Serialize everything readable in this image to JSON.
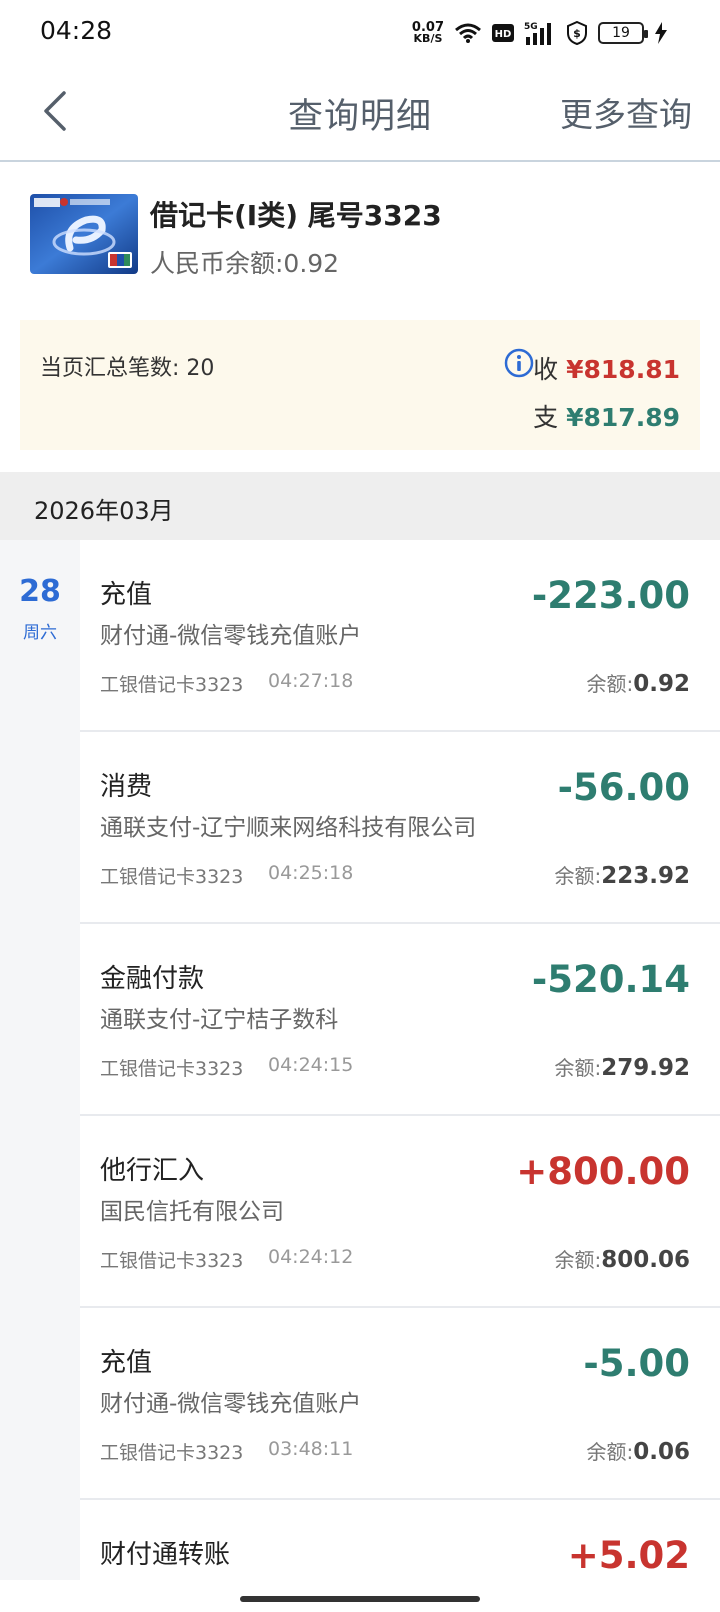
{
  "status": {
    "time": "04:28",
    "net_speed_value": "0.07",
    "net_speed_unit": "KB/S",
    "battery": "19",
    "icons": [
      "wifi-icon",
      "hd-icon",
      "5g-signal-icon",
      "shield-dollar-icon",
      "battery-icon",
      "charging-icon"
    ]
  },
  "nav": {
    "back_icon": "chevron-left-icon",
    "title": "查询明细",
    "more": "更多查询"
  },
  "account": {
    "name": "借记卡(I类)  尾号3323",
    "balance": "人民币余额:0.92",
    "card_image": "icbc-debit-card-image"
  },
  "summary": {
    "count": "当页汇总笔数: 20",
    "income_label": "收",
    "income_amount": "¥818.81",
    "expense_label": "支",
    "expense_amount": "¥817.89",
    "info_icon": "info-icon"
  },
  "month": "2026年03月",
  "date": {
    "day": "28",
    "weekday": "周六"
  },
  "transactions": [
    {
      "type": "充值",
      "merchant": "财付通-微信零钱充值账户",
      "card": "工银借记卡3323",
      "time": "04:27:18",
      "amount": "-223.00",
      "balance_label": "余额:",
      "balance": "0.92"
    },
    {
      "type": "消费",
      "merchant": "通联支付-辽宁顺来网络科技有限公司",
      "card": "工银借记卡3323",
      "time": "04:25:18",
      "amount": "-56.00",
      "balance_label": "余额:",
      "balance": "223.92"
    },
    {
      "type": "金融付款",
      "merchant": "通联支付-辽宁桔子数科",
      "card": "工银借记卡3323",
      "time": "04:24:15",
      "amount": "-520.14",
      "balance_label": "余额:",
      "balance": "279.92"
    },
    {
      "type": "他行汇入",
      "merchant": "国民信托有限公司",
      "card": "工银借记卡3323",
      "time": "04:24:12",
      "amount": "+800.00",
      "balance_label": "余额:",
      "balance": "800.06"
    },
    {
      "type": "充值",
      "merchant": "财付通-微信零钱充值账户",
      "card": "工银借记卡3323",
      "time": "03:48:11",
      "amount": "-5.00",
      "balance_label": "余额:",
      "balance": "0.06"
    },
    {
      "type": "财付通转账",
      "amount": "+5.02"
    }
  ],
  "colors": {
    "debit": "#2e7d70",
    "credit": "#c8342f",
    "date_accent": "#2d6bd4",
    "summary_bg": "#fdf9ec"
  }
}
